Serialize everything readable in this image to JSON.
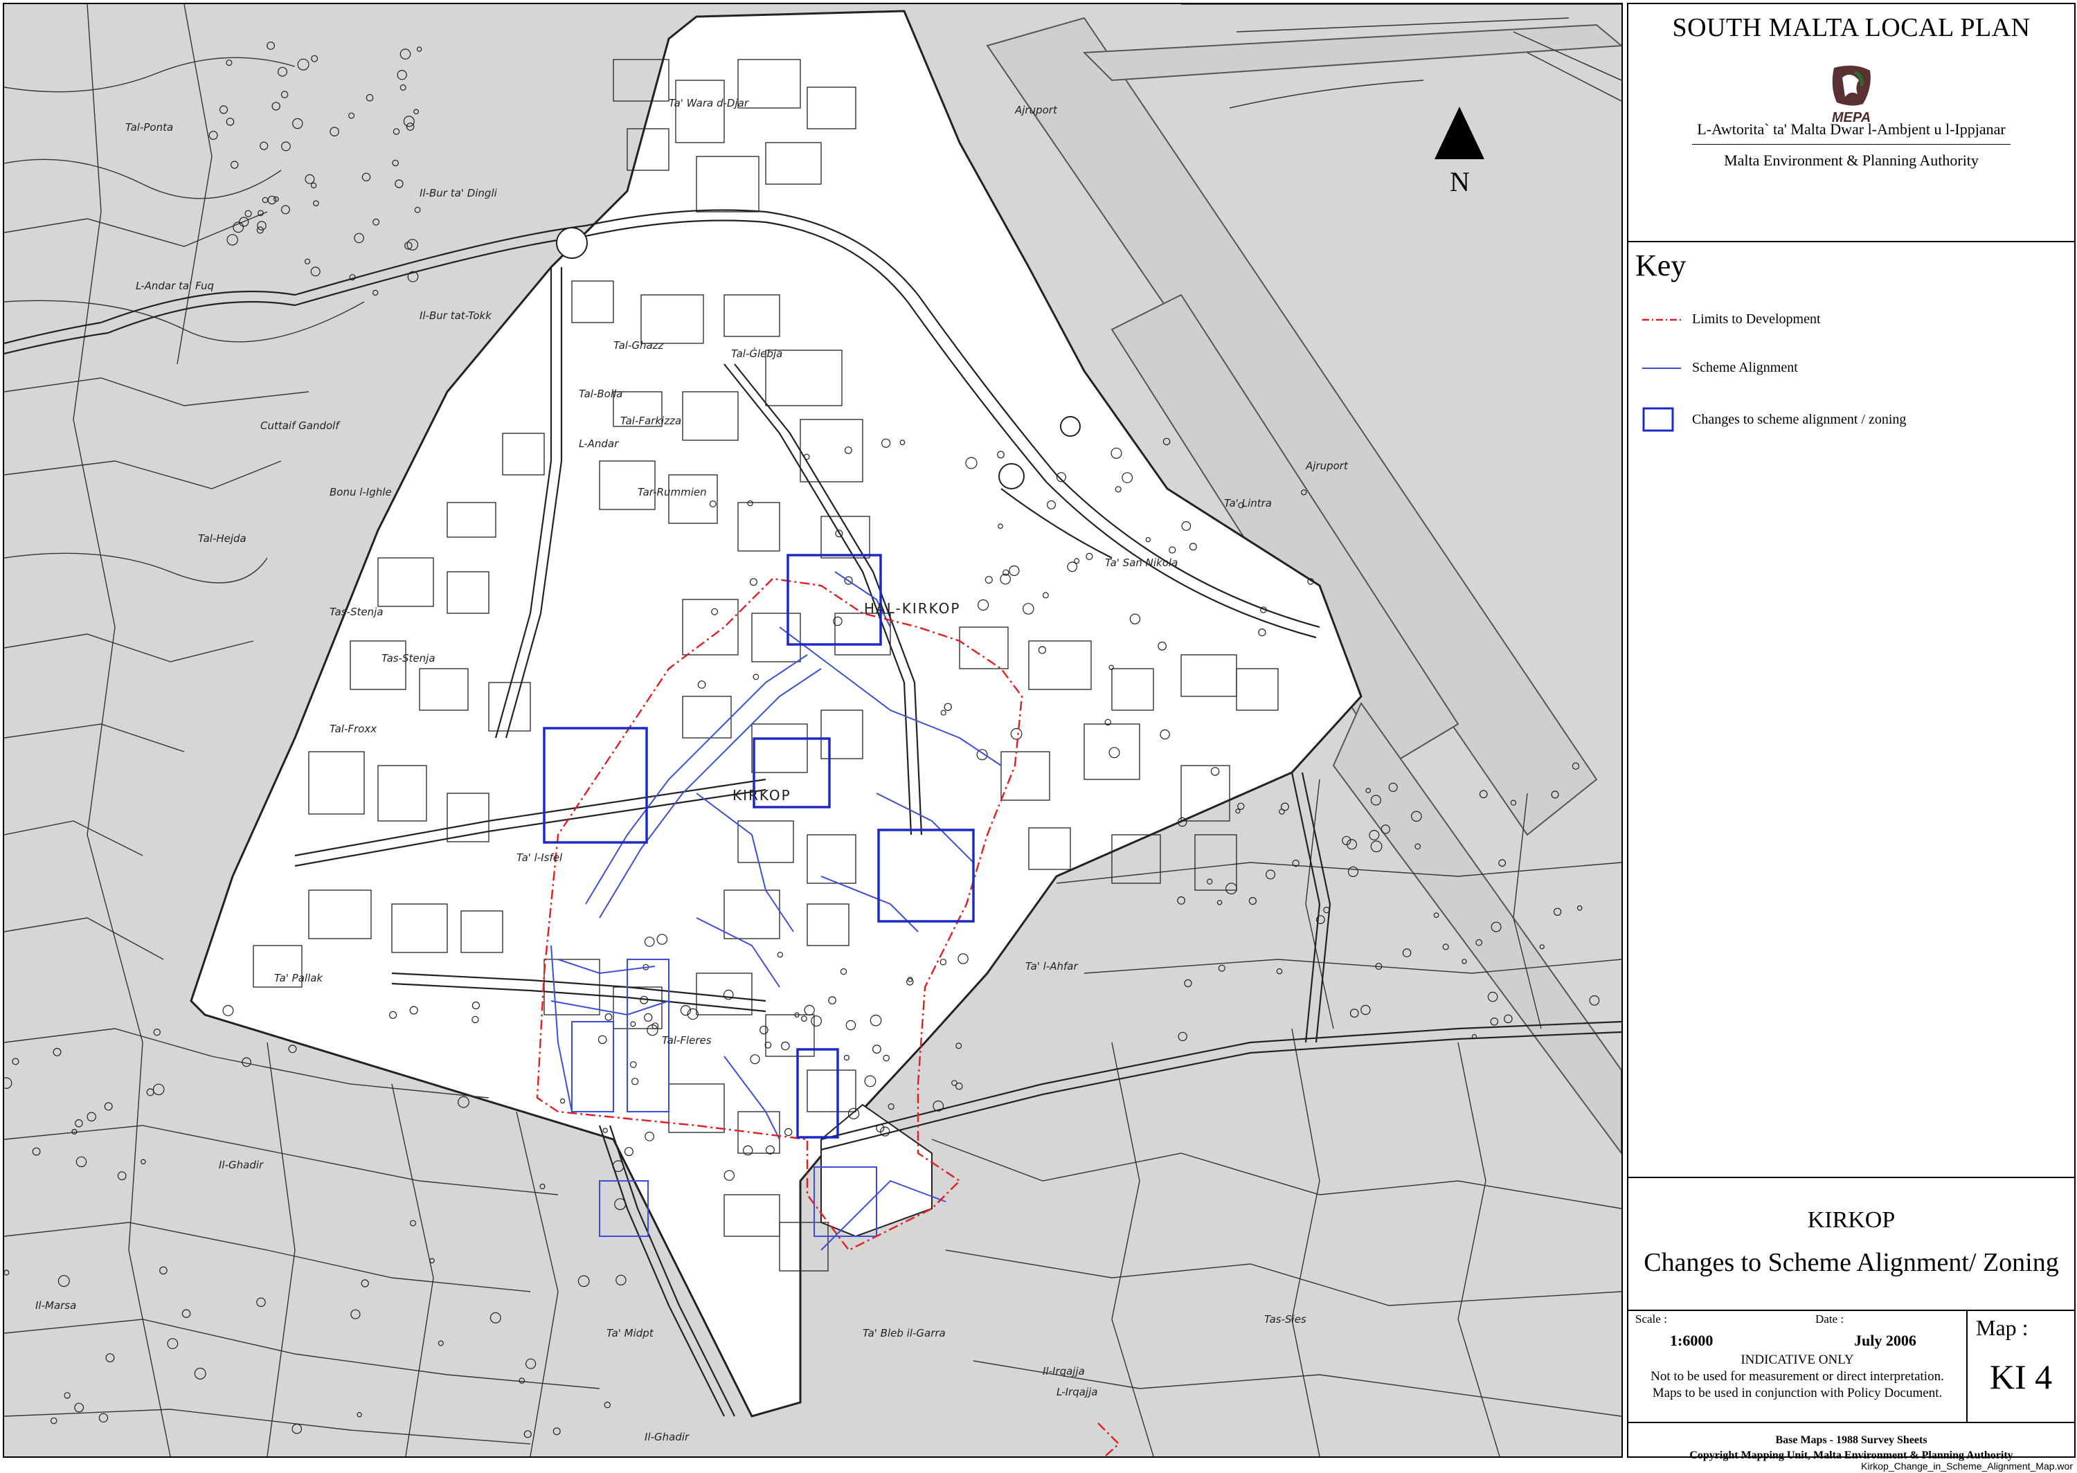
{
  "map": {
    "place_labels": [
      "Ta' Wara d-Djar",
      "Tal-Ponta",
      "Il-Bur ta' Dingli",
      "L-Andar ta' Fuq",
      "Il-Bur tat-Tokk",
      "Tal-Ghazz",
      "Tal-Ġlebja",
      "Tal-Bolla",
      "Tal-Farkizza",
      "L-Andar",
      "Cuttaif Gandolf",
      "Bonu l-Ighle",
      "Tar-Rummien",
      "Tal-Hejda",
      "Tas-Stenja",
      "Tas-Stenja",
      "Tal-Froxx",
      "Ta' Pallak",
      "Ta' l-Isfel",
      "Tal-Fleres",
      "Il-Ghadir",
      "Il-Marsa",
      "Ta' Midpt",
      "Il-Ghadir",
      "Ta' Bleb il-Garra",
      "Il-Irqajja",
      "L-Irqajja",
      "Tas-Sies",
      "Ta' l-Ahfar",
      "Ta' Lintra",
      "Ta' San Nikola",
      "Ajruport",
      "Ajruport"
    ],
    "village_label": "HAL-KIRKOP",
    "core_label": "KIRKOP",
    "north_label": "N",
    "filename": "Kirkop_Change_in_Scheme_Alignment_Map.wor"
  },
  "title_block": {
    "plan_title": "SOUTH MALTA LOCAL PLAN",
    "logo_text": "MEPA",
    "authority_maltese": "L-Awtorita` ta' Malta Dwar l-Ambjent u l-Ippjanar",
    "authority_english": "Malta Environment & Planning Authority"
  },
  "key": {
    "heading": "Key",
    "items": [
      {
        "label": "Limits to Development",
        "symbol": "red-dash-dot-line",
        "color": "#e02020"
      },
      {
        "label": "Scheme Alignment",
        "symbol": "blue-line",
        "color": "#3a4fd8"
      },
      {
        "label": "Changes to scheme alignment / zoning",
        "symbol": "blue-box",
        "color": "#1e28c8"
      }
    ]
  },
  "map_info": {
    "locality": "KIRKOP",
    "title": "Changes to Scheme Alignment/ Zoning",
    "scale_label": "Scale :",
    "scale_value": "1:6000",
    "date_label": "Date :",
    "date_value": "July 2006",
    "note_1": "INDICATIVE ONLY",
    "note_2": "Not to be used for measurement or direct interpretation.",
    "note_3": "Maps to be used in conjunction with Policy Document.",
    "map_label": "Map :",
    "map_number": "KI 4",
    "credit_1": "Base Maps - 1988 Survey Sheets",
    "credit_2": "Copyright Mapping Unit, Malta Environment & Planning Authority"
  }
}
